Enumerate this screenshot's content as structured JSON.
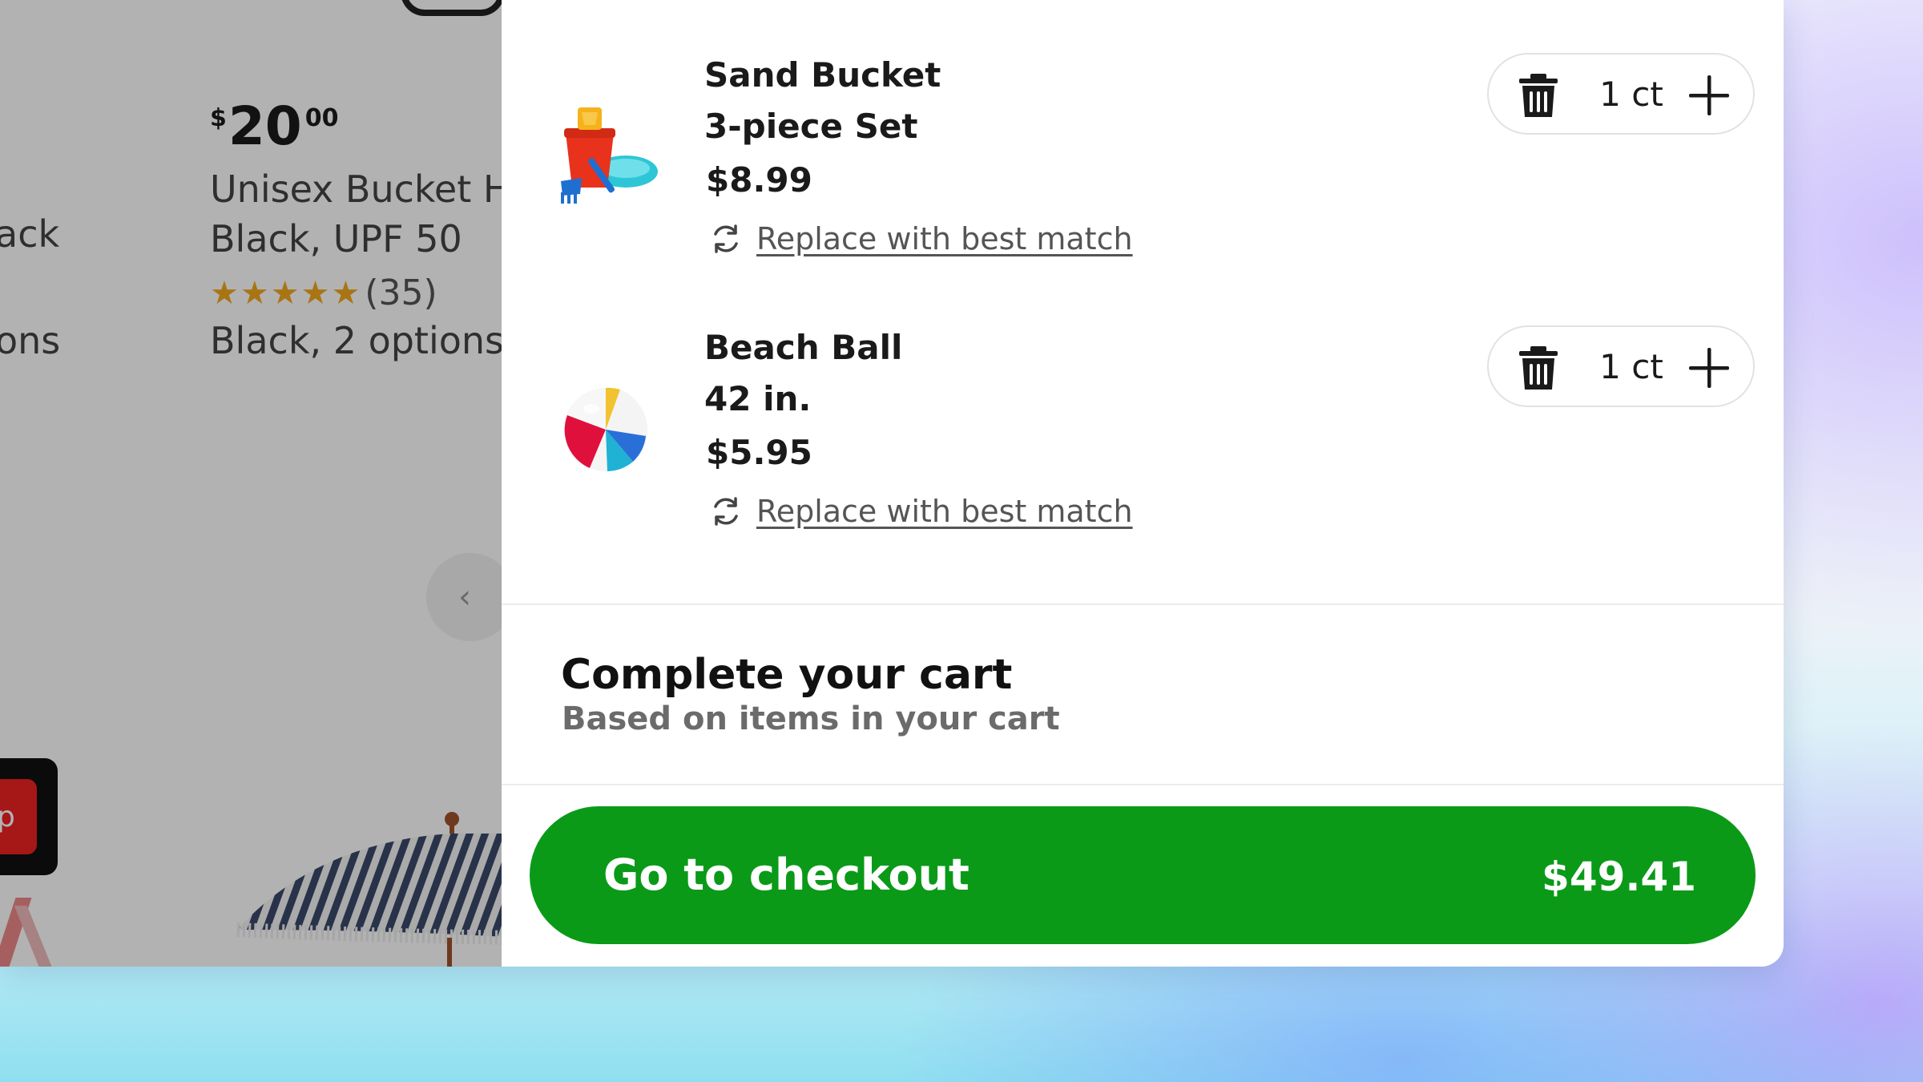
{
  "background_page": {
    "price": {
      "currency": "$",
      "whole": "20",
      "cents": "00"
    },
    "title_line1": "Unisex Bucket H",
    "title_line2": "Black, UPF 50",
    "stars": "★★★★★",
    "rating_count": "(35)",
    "options": "Black, 2 options",
    "left_fragment_1": "ack",
    "left_fragment_2": "ons",
    "red_card_text": "p",
    "carousel_prev_glyph": "‹"
  },
  "cart": {
    "items": [
      {
        "name_line1": "Sand Bucket",
        "name_line2": "3-piece Set",
        "price": "$8.99",
        "replace_label": "Replace with best match",
        "quantity": "1 ct"
      },
      {
        "name_line1": "Beach Ball",
        "name_line2": "42 in.",
        "price": "$5.95",
        "replace_label": "Replace with best match",
        "quantity": "1 ct"
      }
    ],
    "suggestions": {
      "title": "Complete your cart",
      "subtitle": "Based on items in your cart"
    },
    "checkout": {
      "label": "Go to checkout",
      "total": "$49.41"
    }
  },
  "colors": {
    "checkout_green": "#0a9a18",
    "star_gold": "#f2a81d"
  },
  "icons": [
    "trash-icon",
    "plus-icon",
    "refresh-icon",
    "chevron-left-icon"
  ]
}
